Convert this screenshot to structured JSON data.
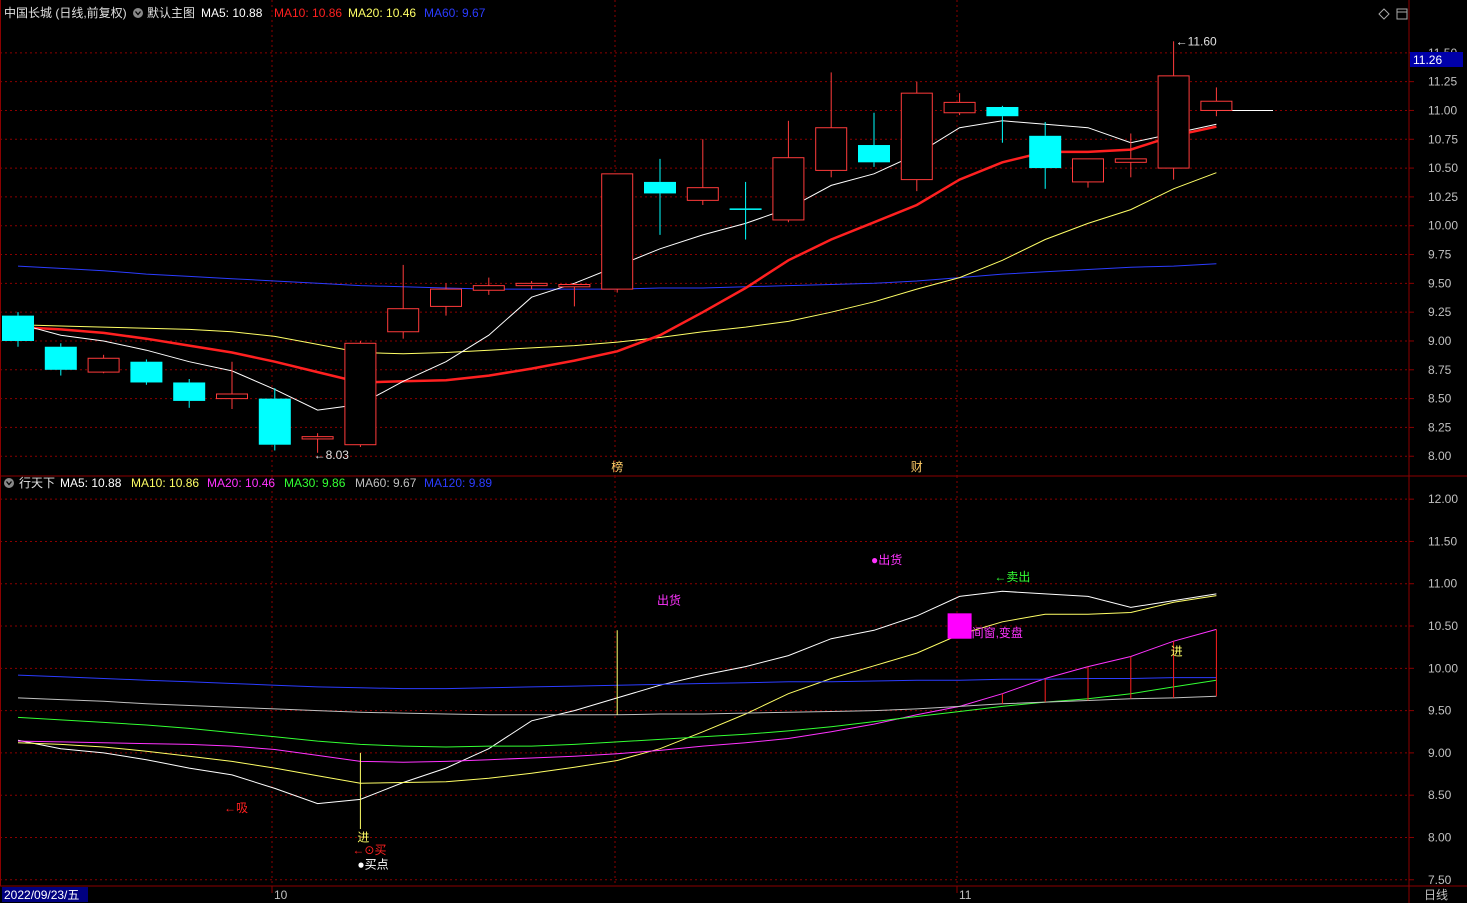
{
  "colors": {
    "up": "#ff3b3b",
    "down": "#00ffff",
    "ma5": "#ffffff",
    "ma10_main": "#ff2020",
    "ma20_main": "#ffff66",
    "ma60_main": "#2b3cff",
    "ma10_sub": "#ffff66",
    "ma20_sub": "#ff33ff",
    "ma30_sub": "#33ff33",
    "ma120_sub": "#2b3cff",
    "grid": "#8b0000",
    "axis_text": "#c0c0c0"
  },
  "main_header": {
    "title": "中国长城 (日线,前复权)",
    "indicator": "默认主图",
    "ma5": "MA5: 10.88",
    "ma10": "MA10: 10.86",
    "ma20": "MA20: 10.46",
    "ma60": "MA60: 9.67"
  },
  "sub_header": {
    "title": "行天下",
    "ma5": "MA5: 10.88",
    "ma10": "MA10: 10.86",
    "ma20": "MA20: 10.46",
    "ma30": "MA30: 9.86",
    "ma60": "MA60: 9.67",
    "ma120": "MA120: 9.89"
  },
  "price_box": "11.26",
  "footer": {
    "date": "2022/09/23/五",
    "month1": "10",
    "month2": "11",
    "period": "日线"
  },
  "icons": {
    "header_dropdown": "circle-chevron-down-icon",
    "diamond": "diamond-icon",
    "window": "window-icon"
  },
  "chart_data": [
    {
      "type": "candlestick",
      "title": "中国长城 (日线,前复权)",
      "ylim": [
        7.95,
        11.75
      ],
      "y_ticks": [
        "11.50",
        "11.25",
        "11.00",
        "10.75",
        "10.50",
        "10.25",
        "10.00",
        "9.75",
        "9.50",
        "9.25",
        "9.00",
        "8.75",
        "8.50",
        "8.25",
        "8.00"
      ],
      "candles": [
        {
          "o": 9.22,
          "h": 9.25,
          "l": 8.95,
          "c": 9.0
        },
        {
          "o": 8.95,
          "h": 8.98,
          "l": 8.7,
          "c": 8.75
        },
        {
          "o": 8.73,
          "h": 8.88,
          "l": 8.72,
          "c": 8.85
        },
        {
          "o": 8.82,
          "h": 8.84,
          "l": 8.62,
          "c": 8.64
        },
        {
          "o": 8.64,
          "h": 8.67,
          "l": 8.42,
          "c": 8.48
        },
        {
          "o": 8.5,
          "h": 8.82,
          "l": 8.41,
          "c": 8.54
        },
        {
          "o": 8.5,
          "h": 8.59,
          "l": 8.05,
          "c": 8.1
        },
        {
          "o": 8.15,
          "h": 8.2,
          "l": 8.03,
          "c": 8.17
        },
        {
          "o": 8.1,
          "h": 9.0,
          "l": 8.08,
          "c": 8.98
        },
        {
          "o": 9.08,
          "h": 9.66,
          "l": 9.02,
          "c": 9.28
        },
        {
          "o": 9.3,
          "h": 9.5,
          "l": 9.22,
          "c": 9.45
        },
        {
          "o": 9.44,
          "h": 9.55,
          "l": 9.4,
          "c": 9.48
        },
        {
          "o": 9.48,
          "h": 9.52,
          "l": 9.45,
          "c": 9.5
        },
        {
          "o": 9.47,
          "h": 9.5,
          "l": 9.3,
          "c": 9.49
        },
        {
          "o": 9.45,
          "h": 9.47,
          "l": 9.42,
          "c": 10.45
        },
        {
          "o": 10.38,
          "h": 10.58,
          "l": 9.92,
          "c": 10.28
        },
        {
          "o": 10.22,
          "h": 10.75,
          "l": 10.18,
          "c": 10.33
        },
        {
          "o": 10.15,
          "h": 10.38,
          "l": 9.88,
          "c": 10.14
        },
        {
          "o": 10.05,
          "h": 10.91,
          "l": 10.03,
          "c": 10.59
        },
        {
          "o": 10.48,
          "h": 11.33,
          "l": 10.42,
          "c": 10.85
        },
        {
          "o": 10.7,
          "h": 10.98,
          "l": 10.51,
          "c": 10.55
        },
        {
          "o": 10.4,
          "h": 11.25,
          "l": 10.3,
          "c": 11.15
        },
        {
          "o": 10.98,
          "h": 11.15,
          "l": 10.96,
          "c": 11.07
        },
        {
          "o": 11.03,
          "h": 11.04,
          "l": 10.72,
          "c": 10.95
        },
        {
          "o": 10.78,
          "h": 10.9,
          "l": 10.32,
          "c": 10.5
        },
        {
          "o": 10.38,
          "h": 10.58,
          "l": 10.33,
          "c": 10.58
        },
        {
          "o": 10.55,
          "h": 10.8,
          "l": 10.42,
          "c": 10.58
        },
        {
          "o": 10.5,
          "h": 11.6,
          "l": 10.4,
          "c": 11.3
        },
        {
          "o": 11.0,
          "h": 11.2,
          "l": 10.95,
          "c": 11.08
        }
      ],
      "ma5": [
        9.15,
        9.05,
        9.0,
        8.92,
        8.82,
        8.74,
        8.58,
        8.4,
        8.45,
        8.65,
        8.82,
        9.05,
        9.38,
        9.5,
        9.65,
        9.8,
        9.92,
        10.02,
        10.15,
        10.35,
        10.45,
        10.62,
        10.85,
        10.91,
        10.88,
        10.85,
        10.72,
        10.8,
        10.88
      ],
      "ma10": [
        9.12,
        9.1,
        9.07,
        9.02,
        8.96,
        8.9,
        8.82,
        8.73,
        8.64,
        8.65,
        8.66,
        8.7,
        8.76,
        8.83,
        8.91,
        9.05,
        9.25,
        9.46,
        9.7,
        9.88,
        10.03,
        10.18,
        10.4,
        10.55,
        10.64,
        10.64,
        10.66,
        10.78,
        10.86
      ],
      "ma20": [
        9.14,
        9.13,
        9.12,
        9.11,
        9.1,
        9.08,
        9.04,
        8.97,
        8.9,
        8.89,
        8.9,
        8.92,
        8.94,
        8.96,
        8.99,
        9.03,
        9.08,
        9.12,
        9.17,
        9.25,
        9.34,
        9.45,
        9.55,
        9.7,
        9.88,
        10.02,
        10.14,
        10.32,
        10.46
      ],
      "ma60": [
        9.65,
        9.63,
        9.61,
        9.58,
        9.56,
        9.54,
        9.52,
        9.5,
        9.48,
        9.47,
        9.46,
        9.45,
        9.45,
        9.45,
        9.45,
        9.46,
        9.46,
        9.47,
        9.48,
        9.49,
        9.5,
        9.52,
        9.55,
        9.58,
        9.6,
        9.62,
        9.64,
        9.65,
        9.67
      ],
      "annotations": [
        {
          "text": "←8.03",
          "candle": 7,
          "y": 8.03
        },
        {
          "text": "←11.60",
          "candle": 27,
          "y": 11.6
        },
        {
          "text": "榜",
          "candle": 14
        },
        {
          "text": "财",
          "candle": 21
        }
      ]
    },
    {
      "type": "line",
      "title": "行天下",
      "ylim": [
        7.45,
        12.25
      ],
      "y_ticks": [
        "12.00",
        "11.50",
        "11.00",
        "10.50",
        "10.00",
        "9.50",
        "9.00",
        "8.50",
        "8.00",
        "7.50"
      ],
      "series": [
        {
          "name": "MA5",
          "values": [
            9.15,
            9.05,
            9.0,
            8.92,
            8.82,
            8.74,
            8.58,
            8.4,
            8.45,
            8.65,
            8.82,
            9.05,
            9.38,
            9.5,
            9.65,
            9.8,
            9.92,
            10.02,
            10.15,
            10.35,
            10.45,
            10.62,
            10.85,
            10.91,
            10.88,
            10.85,
            10.72,
            10.8,
            10.88
          ]
        },
        {
          "name": "MA10",
          "values": [
            9.12,
            9.1,
            9.07,
            9.02,
            8.96,
            8.9,
            8.82,
            8.73,
            8.64,
            8.65,
            8.66,
            8.7,
            8.76,
            8.83,
            8.91,
            9.05,
            9.25,
            9.46,
            9.7,
            9.88,
            10.03,
            10.18,
            10.4,
            10.55,
            10.64,
            10.64,
            10.66,
            10.78,
            10.86
          ]
        },
        {
          "name": "MA20",
          "values": [
            9.14,
            9.13,
            9.12,
            9.11,
            9.1,
            9.08,
            9.04,
            8.97,
            8.9,
            8.89,
            8.9,
            8.92,
            8.94,
            8.96,
            8.99,
            9.03,
            9.08,
            9.12,
            9.17,
            9.25,
            9.34,
            9.45,
            9.55,
            9.7,
            9.88,
            10.02,
            10.14,
            10.32,
            10.46
          ]
        },
        {
          "name": "MA30",
          "values": [
            9.42,
            9.39,
            9.36,
            9.33,
            9.29,
            9.24,
            9.19,
            9.14,
            9.1,
            9.08,
            9.07,
            9.08,
            9.08,
            9.1,
            9.13,
            9.16,
            9.19,
            9.22,
            9.26,
            9.31,
            9.37,
            9.43,
            9.49,
            9.55,
            9.6,
            9.64,
            9.7,
            9.78,
            9.86
          ]
        },
        {
          "name": "MA60",
          "values": [
            9.65,
            9.63,
            9.61,
            9.58,
            9.56,
            9.54,
            9.52,
            9.5,
            9.48,
            9.47,
            9.46,
            9.45,
            9.45,
            9.45,
            9.45,
            9.46,
            9.46,
            9.47,
            9.48,
            9.49,
            9.5,
            9.52,
            9.55,
            9.58,
            9.6,
            9.62,
            9.64,
            9.65,
            9.67
          ]
        },
        {
          "name": "MA120",
          "values": [
            9.92,
            9.9,
            9.88,
            9.86,
            9.84,
            9.82,
            9.8,
            9.78,
            9.77,
            9.76,
            9.76,
            9.77,
            9.78,
            9.79,
            9.8,
            9.81,
            9.82,
            9.83,
            9.84,
            9.84,
            9.85,
            9.86,
            9.86,
            9.87,
            9.87,
            9.88,
            9.88,
            9.89,
            9.89
          ]
        }
      ],
      "annotations": [
        {
          "text": "←吸",
          "candle": 5,
          "y": 8.35,
          "color": "#ff2020"
        },
        {
          "text": "进",
          "candle": 8,
          "y": 8.0,
          "color": "#ffff66"
        },
        {
          "text": "←⊙买",
          "candle": 8,
          "y": 7.85,
          "color": "#ff2020"
        },
        {
          "text": "●买点",
          "candle": 8,
          "y": 7.68,
          "color": "#ffffff"
        },
        {
          "text": "出货",
          "candle": 15,
          "y": 10.8,
          "color": "#ff33ff"
        },
        {
          "text": "●出货",
          "candle": 20,
          "y": 11.28,
          "color": "#ff33ff"
        },
        {
          "text": "←卖出",
          "candle": 23,
          "y": 11.08,
          "color": "#33ff33"
        },
        {
          "text": "间窗,变盘",
          "candle": 22,
          "y": 10.42,
          "color": "#ff33ff"
        },
        {
          "text": "进",
          "candle": 27,
          "y": 10.2,
          "color": "#ffff66"
        }
      ]
    }
  ]
}
